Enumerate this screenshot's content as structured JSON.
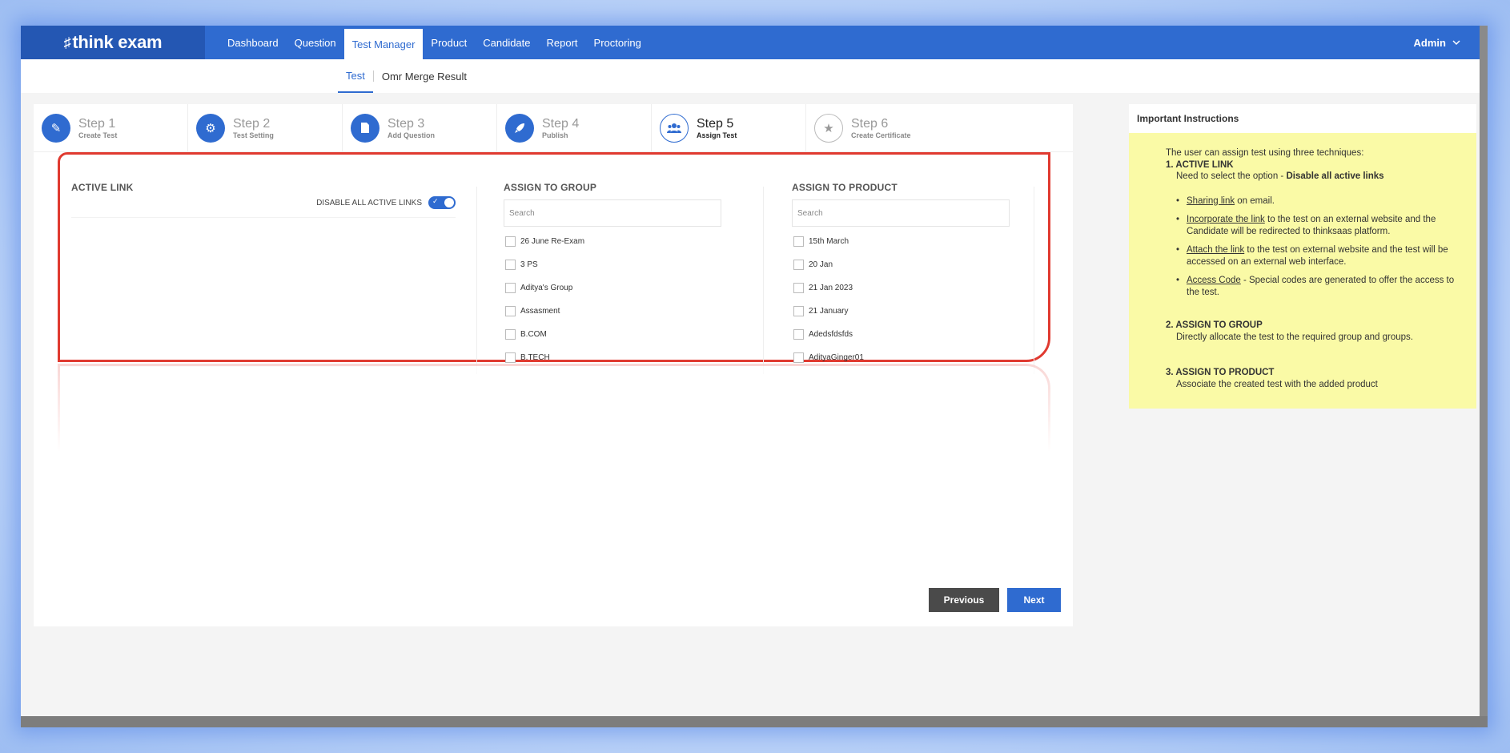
{
  "app": {
    "logo_text": "think exam",
    "nav": [
      "Dashboard",
      "Question",
      "Test Manager",
      "Product",
      "Candidate",
      "Report",
      "Proctoring"
    ],
    "user": "Admin"
  },
  "subnav": [
    "Test",
    "Omr Merge Result"
  ],
  "steps": [
    {
      "title": "Step 1",
      "sub": "Create Test"
    },
    {
      "title": "Step 2",
      "sub": "Test Setting"
    },
    {
      "title": "Step 3",
      "sub": "Add Question"
    },
    {
      "title": "Step 4",
      "sub": "Publish"
    },
    {
      "title": "Step 5",
      "sub": "Assign Test"
    },
    {
      "title": "Step 6",
      "sub": "Create Certificate"
    }
  ],
  "active_link": {
    "heading": "ACTIVE LINK",
    "toggle_label": "DISABLE ALL ACTIVE LINKS"
  },
  "group": {
    "heading": "ASSIGN TO GROUP",
    "search_placeholder": "Search",
    "items": [
      "26 June Re-Exam",
      "3 PS",
      "Aditya's Group",
      "Assasment",
      "B.COM",
      "B.TECH",
      ""
    ]
  },
  "product": {
    "heading": "ASSIGN TO PRODUCT",
    "search_placeholder": "Search",
    "items": [
      "15th March",
      "20 Jan",
      "21 Jan 2023",
      "21 January",
      "Adedsfdsfds",
      "AdityaGinger01",
      ""
    ]
  },
  "buttons": {
    "previous": "Previous",
    "next": "Next"
  },
  "instructions": {
    "title": "Important Instructions",
    "intro": "The user can assign test using three techniques:",
    "s1_title": "1. ACTIVE LINK",
    "s1_desc_pre": "Need to select the option - ",
    "s1_desc_bold": "Disable all active links",
    "b1_link": "Sharing link",
    "b1_rest": " on email.",
    "b2_link": "Incorporate the link",
    "b2_rest": " to the test on an external website and the Candidate will be redirected to thinksaas platform.",
    "b3_link": "Attach the link",
    "b3_rest": " to the test on external website and the test will be accessed on an external web interface.",
    "b4_link": "Access Code",
    "b4_rest": " - Special codes are generated to offer the access to the test.",
    "s2_title": "2. ASSIGN TO GROUP",
    "s2_desc": "Directly allocate the test to the required group and groups.",
    "s3_title": "3. ASSIGN TO PRODUCT",
    "s3_desc": "Associate the created test with the added product"
  }
}
